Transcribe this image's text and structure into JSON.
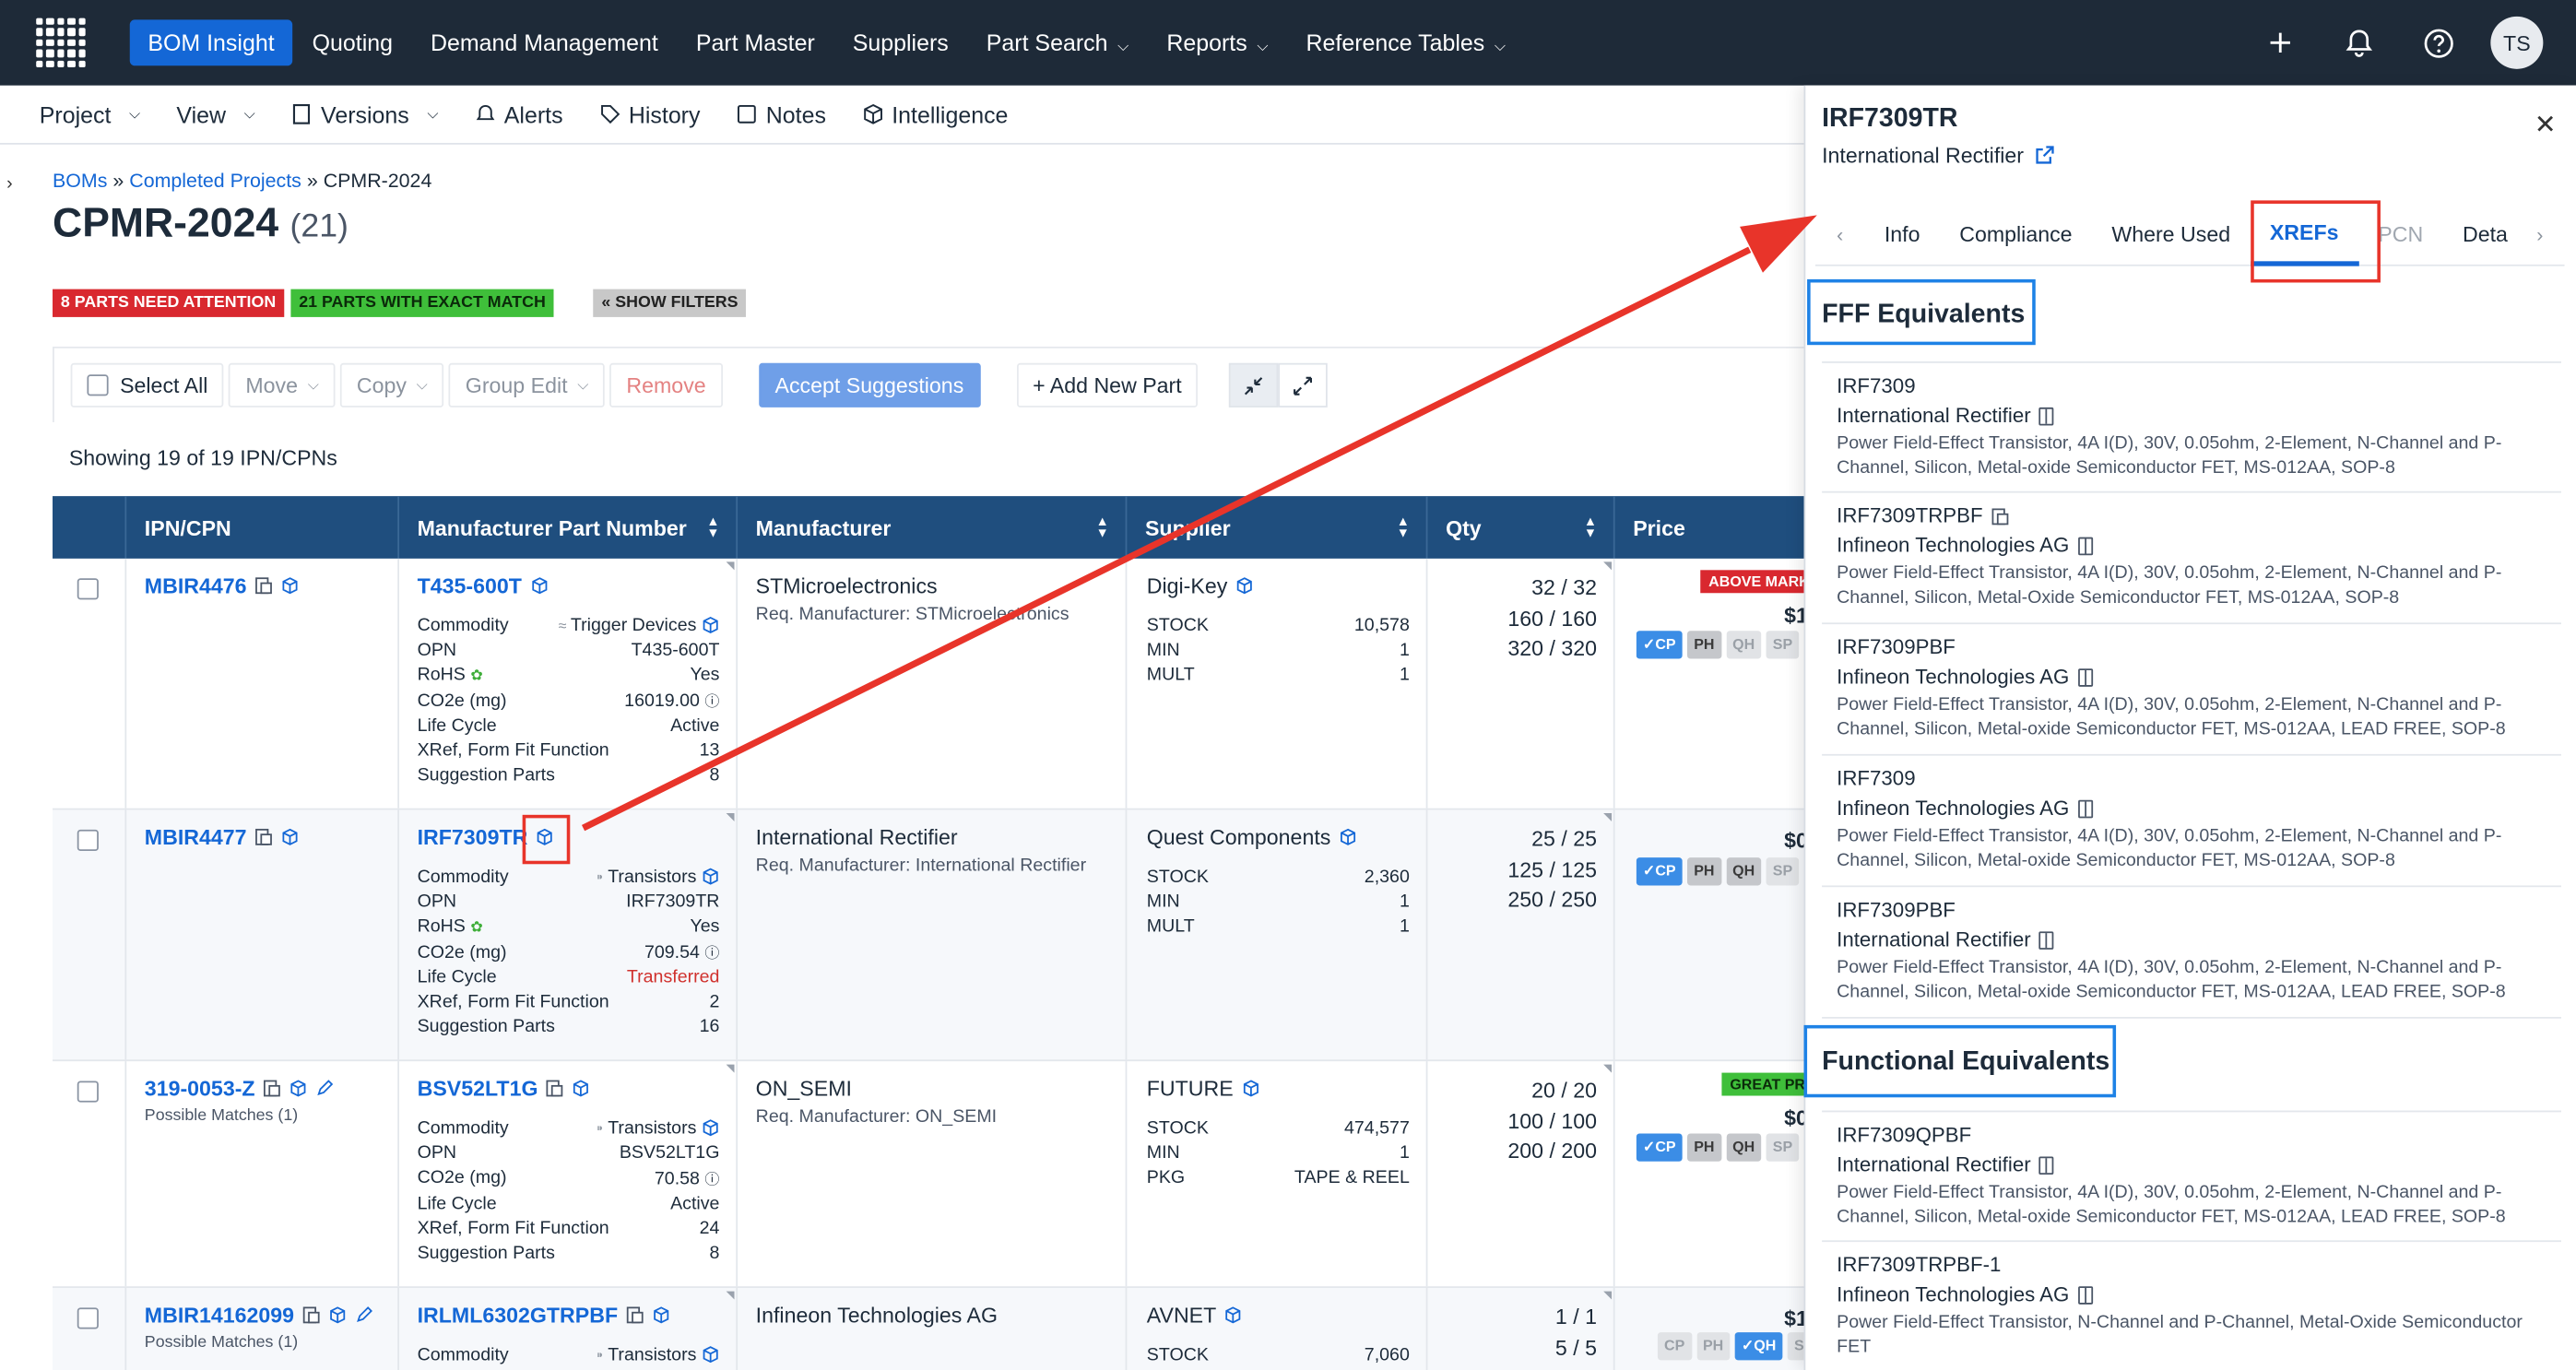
{
  "nav": {
    "items": [
      {
        "label": "BOM Insight",
        "active": true,
        "dropdown": false
      },
      {
        "label": "Quoting",
        "dropdown": false
      },
      {
        "label": "Demand Management",
        "dropdown": false
      },
      {
        "label": "Part Master",
        "dropdown": false
      },
      {
        "label": "Suppliers",
        "dropdown": false
      },
      {
        "label": "Part Search",
        "dropdown": true
      },
      {
        "label": "Reports",
        "dropdown": true
      },
      {
        "label": "Reference Tables",
        "dropdown": true
      }
    ],
    "user_initials": "TS",
    "icons": [
      "plus-icon",
      "bell-icon",
      "help-icon"
    ]
  },
  "toolbar": {
    "project": "Project",
    "view": "View",
    "versions": "Versions",
    "alerts": "Alerts",
    "history": "History",
    "notes": "Notes",
    "intelligence": "Intelligence"
  },
  "breadcrumb": {
    "boms": "BOMs",
    "sep": "»",
    "completed": "Completed Projects",
    "current": "CPMR-2024"
  },
  "page": {
    "title": "CPMR-2024",
    "count": "(21)"
  },
  "badges": {
    "attention": "8 PARTS NEED ATTENTION",
    "exact": "21 PARTS WITH EXACT MATCH",
    "filters": "« SHOW FILTERS"
  },
  "actions": {
    "select_all": "Select All",
    "move": "Move",
    "copy": "Copy",
    "group_edit": "Group Edit",
    "remove": "Remove",
    "accept": "Accept Suggestions",
    "add": "+ Add New Part"
  },
  "showing": "Showing 19 of 19 IPN/CPNs",
  "columns": {
    "ipn": "IPN/CPN",
    "mpn": "Manufacturer Part Number",
    "mfr": "Manufacturer",
    "supplier": "Supplier",
    "qty": "Qty",
    "price": "Price"
  },
  "rows": [
    {
      "ipn": "MBIR4476",
      "ipn_sub": "",
      "mpn": "T435-600T",
      "attrs": [
        {
          "k": "Commodity",
          "v": "Trigger Devices"
        },
        {
          "k": "OPN",
          "v": "T435-600T"
        },
        {
          "k": "RoHS",
          "v": "Yes"
        },
        {
          "k": "CO2e (mg)",
          "v": "16019.00"
        },
        {
          "k": "Life Cycle",
          "v": "Active"
        },
        {
          "k": "XRef, Form Fit Function",
          "v": "13"
        },
        {
          "k": "Suggestion Parts",
          "v": "8"
        }
      ],
      "mfr": "STMicroelectronics",
      "req": "Req. Manufacturer: STMicroelectronics",
      "supplier": "Digi-Key",
      "sup_attrs": [
        {
          "k": "STOCK",
          "v": "10,578"
        },
        {
          "k": "MIN",
          "v": "1"
        },
        {
          "k": "MULT",
          "v": "1"
        }
      ],
      "qty": [
        "32 / 32",
        "160 / 160",
        "320 / 320"
      ],
      "price_badge": "ABOVE MARKET",
      "price": "$1",
      "chips": [
        "✓CP",
        "PH",
        "QH",
        "SP"
      ]
    },
    {
      "ipn": "MBIR4477",
      "ipn_sub": "",
      "mpn": "IRF7309TR",
      "attrs": [
        {
          "k": "Commodity",
          "v": "Transistors"
        },
        {
          "k": "OPN",
          "v": "IRF7309TR"
        },
        {
          "k": "RoHS",
          "v": "Yes"
        },
        {
          "k": "CO2e (mg)",
          "v": "709.54"
        },
        {
          "k": "Life Cycle",
          "v": "Transferred"
        },
        {
          "k": "XRef, Form Fit Function",
          "v": "2"
        },
        {
          "k": "Suggestion Parts",
          "v": "16"
        }
      ],
      "mfr": "International Rectifier",
      "req": "Req. Manufacturer: International Rectifier",
      "supplier": "Quest Components",
      "sup_attrs": [
        {
          "k": "STOCK",
          "v": "2,360"
        },
        {
          "k": "MIN",
          "v": "1"
        },
        {
          "k": "MULT",
          "v": "1"
        }
      ],
      "qty": [
        "25 / 25",
        "125 / 125",
        "250 / 250"
      ],
      "price_badge": "",
      "price": "$0",
      "chips": [
        "✓CP",
        "PH",
        "QH",
        "SP"
      ]
    },
    {
      "ipn": "319-0053-Z",
      "ipn_sub": "Possible Matches (1)",
      "mpn": "BSV52LT1G",
      "attrs": [
        {
          "k": "Commodity",
          "v": "Transistors"
        },
        {
          "k": "OPN",
          "v": "BSV52LT1G"
        },
        {
          "k": "CO2e (mg)",
          "v": "70.58"
        },
        {
          "k": "Life Cycle",
          "v": "Active"
        },
        {
          "k": "XRef, Form Fit Function",
          "v": "24"
        },
        {
          "k": "Suggestion Parts",
          "v": "8"
        }
      ],
      "mfr": "ON_SEMI",
      "req": "Req. Manufacturer: ON_SEMI",
      "supplier": "FUTURE",
      "sup_attrs": [
        {
          "k": "STOCK",
          "v": "474,577"
        },
        {
          "k": "MIN",
          "v": "1"
        },
        {
          "k": "PKG",
          "v": "TAPE & REEL"
        }
      ],
      "qty": [
        "20 / 20",
        "100 / 100",
        "200 / 200"
      ],
      "price_badge": "GREAT PRICE",
      "price": "$0",
      "chips": [
        "✓CP",
        "PH",
        "QH",
        "SP"
      ]
    },
    {
      "ipn": "MBIR14162099",
      "ipn_sub": "Possible Matches (1)",
      "mpn": "IRLML6302GTRPBF",
      "attrs": [
        {
          "k": "Commodity",
          "v": "Transistors"
        }
      ],
      "mfr": "Infineon Technologies AG",
      "req": "",
      "supplier": "AVNET",
      "sup_attrs": [
        {
          "k": "STOCK",
          "v": "7,060"
        }
      ],
      "qty": [
        "1 / 1",
        "5 / 5"
      ],
      "price_badge": "",
      "price": "$1",
      "chips": [
        "CP",
        "PH",
        "✓QH",
        "SP"
      ]
    }
  ],
  "panel": {
    "title": "IRF7309TR",
    "manufacturer": "International Rectifier",
    "tabs": [
      "Info",
      "Compliance",
      "Where Used",
      "XREFs",
      "PCN",
      "Deta"
    ],
    "active_tab": "XREFs",
    "fff_heading": "FFF Equivalents",
    "fff": [
      {
        "name": "IRF7309",
        "mfr": "International Rectifier",
        "desc": "Power Field-Effect Transistor, 4A I(D), 30V, 0.05ohm, 2-Element, N-Channel and P-Channel, Silicon, Metal-oxide Semiconductor FET, MS-012AA, SOP-8"
      },
      {
        "name": "IRF7309TRPBF",
        "mfr": "Infineon Technologies AG",
        "desc": "Power Field-Effect Transistor, 4A I(D), 30V, 0.05ohm, 2-Element, N-Channel and P-Channel, Silicon, Metal-Oxide Semiconductor FET, MS-012AA, SOP-8"
      },
      {
        "name": "IRF7309PBF",
        "mfr": "Infineon Technologies AG",
        "desc": "Power Field-Effect Transistor, 4A I(D), 30V, 0.05ohm, 2-Element, N-Channel and P-Channel, Silicon, Metal-oxide Semiconductor FET, MS-012AA, LEAD FREE, SOP-8"
      },
      {
        "name": "IRF7309",
        "mfr": "Infineon Technologies AG",
        "desc": "Power Field-Effect Transistor, 4A I(D), 30V, 0.05ohm, 2-Element, N-Channel and P-Channel, Silicon, Metal-oxide Semiconductor FET, MS-012AA, SOP-8"
      },
      {
        "name": "IRF7309PBF",
        "mfr": "International Rectifier",
        "desc": "Power Field-Effect Transistor, 4A I(D), 30V, 0.05ohm, 2-Element, N-Channel and P-Channel, Silicon, Metal-oxide Semiconductor FET, MS-012AA, LEAD FREE, SOP-8"
      }
    ],
    "func_heading": "Functional Equivalents",
    "func": [
      {
        "name": "IRF7309QPBF",
        "mfr": "International Rectifier",
        "desc": "Power Field-Effect Transistor, 4A I(D), 30V, 0.05ohm, 2-Element, N-Channel and P-Channel, Silicon, Metal-oxide Semiconductor FET, MS-012AA, LEAD FREE, SOP-8"
      },
      {
        "name": "IRF7309TRPBF-1",
        "mfr": "Infineon Technologies AG",
        "desc": "Power Field-Effect Transistor, N-Channel and P-Channel, Metal-Oxide Semiconductor FET"
      }
    ]
  },
  "colors": {
    "nav_bg": "#1e2a38",
    "accent": "#1467d6",
    "header_bg": "#1f4e7e",
    "annotation_red": "#e8342a",
    "annotation_blue": "#1e82e6"
  }
}
